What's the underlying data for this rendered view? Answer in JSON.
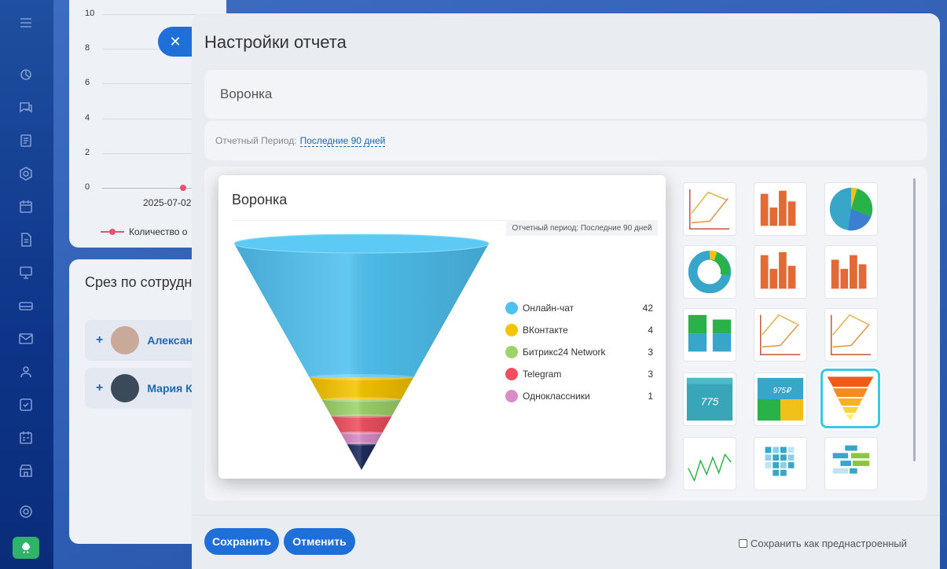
{
  "background": {
    "y_ticks": [
      "10",
      "8",
      "6",
      "4",
      "2",
      "0"
    ],
    "x_date": "2025-07-02",
    "legend_label": "Количество о",
    "slice_title": "Срез по сотрудн",
    "employees": [
      {
        "name": "Алексан"
      },
      {
        "name": "Мария К"
      }
    ]
  },
  "slider": {
    "title": "Настройки отчета",
    "report_name": "Воронка",
    "period_label": "Отчетный Период:",
    "period_value": "Последние 90 дней",
    "footer": {
      "save_label": "Сохранить",
      "cancel_label": "Отменить",
      "preset_label": "Сохранить как преднастроенный"
    }
  },
  "popup": {
    "title": "Воронка",
    "period_text": "Отчетный период: Последние 90 дней",
    "legend": [
      {
        "name": "Онлайн-чат",
        "value": "42",
        "color": "#4fc1f0"
      },
      {
        "name": "ВКонтакте",
        "value": "4",
        "color": "#f5c400"
      },
      {
        "name": "Битрикс24 Network",
        "value": "3",
        "color": "#9dd36a"
      },
      {
        "name": "Telegram",
        "value": "3",
        "color": "#ef5060"
      },
      {
        "name": "Одноклассники",
        "value": "1",
        "color": "#d98cc6"
      }
    ]
  },
  "chart_data": {
    "type": "funnel",
    "title": "Воронка",
    "categories": [
      "Онлайн-чат",
      "ВКонтакте",
      "Битрикс24 Network",
      "Telegram",
      "Одноклассники"
    ],
    "values": [
      42,
      4,
      3,
      3,
      1
    ],
    "colors": [
      "#4fc1f0",
      "#f5c400",
      "#9dd36a",
      "#ef5060",
      "#d98cc6",
      "#1f2d5e"
    ]
  },
  "gallery_thumbs": [
    {
      "kind": "line-chart-icon"
    },
    {
      "kind": "bar-chart-icon"
    },
    {
      "kind": "pie-chart-icon"
    },
    {
      "kind": "donut-chart-icon"
    },
    {
      "kind": "bar-chart-icon"
    },
    {
      "kind": "bar-chart-icon"
    },
    {
      "kind": "stacked-bar-icon"
    },
    {
      "kind": "line-chart-icon"
    },
    {
      "kind": "line-chart-icon"
    },
    {
      "kind": "number-widget-icon",
      "text": "775"
    },
    {
      "kind": "number-grid-icon",
      "text": "975₽"
    },
    {
      "kind": "funnel-icon"
    },
    {
      "kind": "sparkline-icon"
    },
    {
      "kind": "heatmap-icon"
    },
    {
      "kind": "gantt-icon"
    }
  ]
}
